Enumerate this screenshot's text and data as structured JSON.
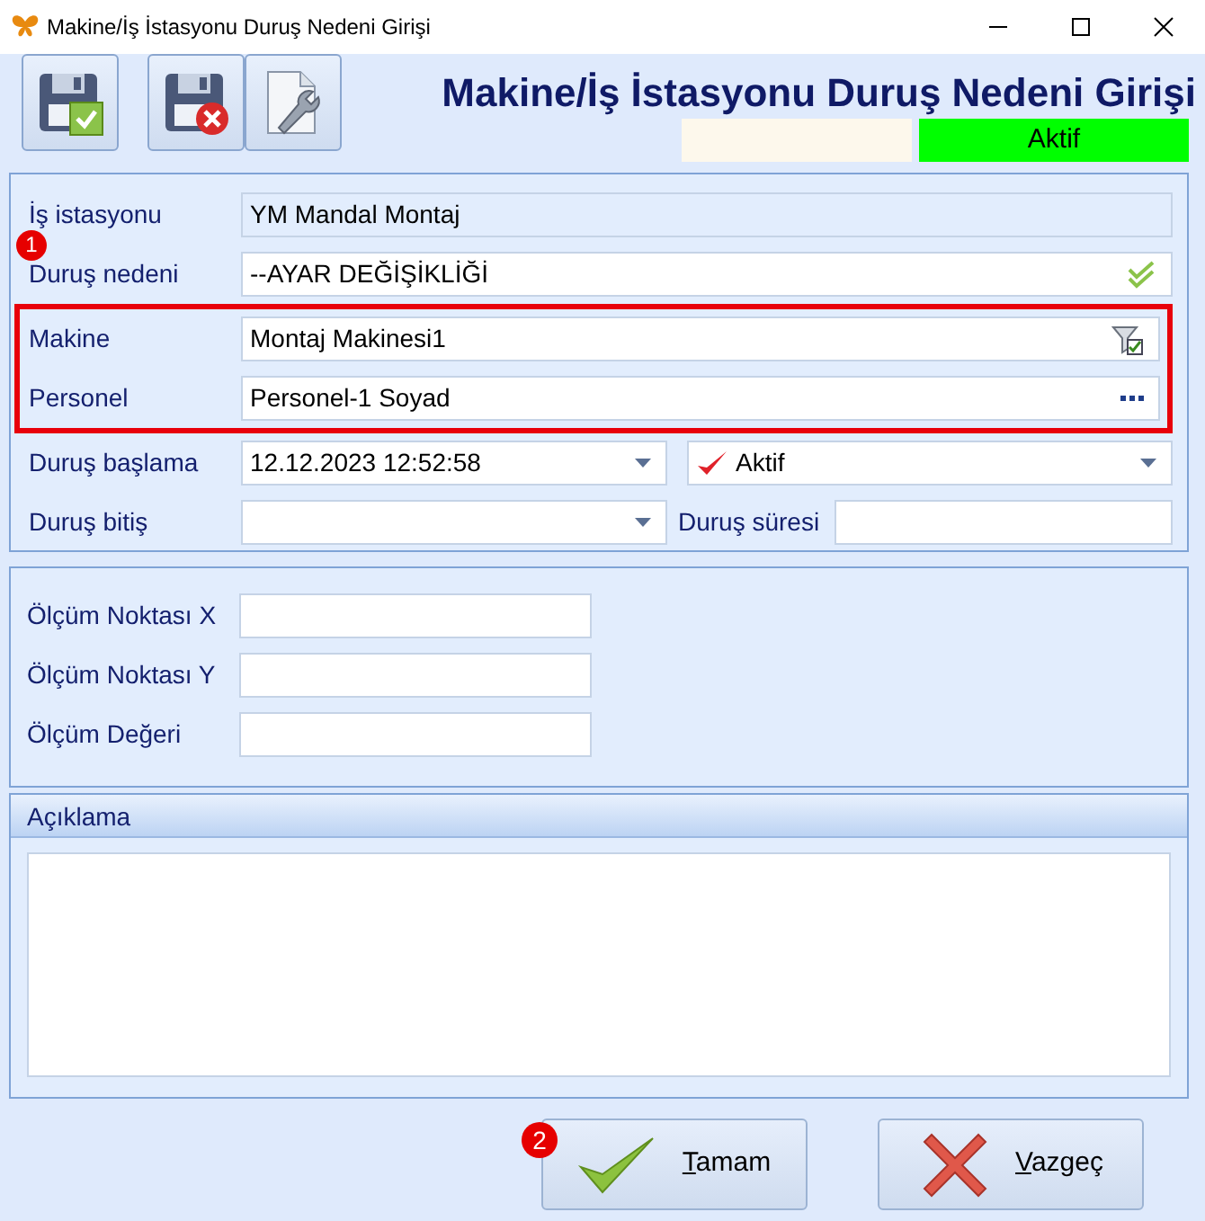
{
  "window": {
    "title": "Makine/İş İstasyonu Duruş Nedeni Girişi"
  },
  "header": {
    "title": "Makine/İş İstasyonu Duruş Nedeni Girişi",
    "status": "Aktif"
  },
  "form": {
    "callout": "1",
    "rows": [
      {
        "highlighted": false,
        "items": [
          {
            "label": "İş istasyonu",
            "value": "YM Mandal Montaj",
            "kind": "readonly"
          }
        ]
      },
      {
        "highlighted": false,
        "items": [
          {
            "label": "Duruş nedeni",
            "value": "--AYAR DEĞİŞİKLİĞİ",
            "kind": "check-lookup"
          }
        ]
      },
      {
        "highlighted": true,
        "items": [
          {
            "label": "Makine",
            "value": "Montaj Makinesi1",
            "kind": "filter-lookup"
          }
        ]
      },
      {
        "highlighted": true,
        "items": [
          {
            "label": "Personel",
            "value": "Personel-1 Soyad",
            "kind": "ellipsis"
          }
        ]
      },
      {
        "highlighted": false,
        "items": [
          {
            "label": "Duruş başlama",
            "value": "12.12.2023 12:52:58",
            "kind": "dropdown"
          },
          {
            "value": "Aktif",
            "kind": "status-dropdown"
          }
        ]
      },
      {
        "highlighted": false,
        "items": [
          {
            "label": "Duruş bitiş",
            "kind": "dropdown"
          },
          {
            "label": "Duruş süresi",
            "kind": "text"
          }
        ]
      }
    ]
  },
  "measurements": [
    {
      "label": "Ölçüm Noktası X"
    },
    {
      "label": "Ölçüm Noktası Y"
    },
    {
      "label": "Ölçüm Değeri"
    }
  ],
  "notes": {
    "title": "Açıklama"
  },
  "buttons": {
    "callout": "2",
    "items": [
      {
        "label": "Tamam",
        "kind": "ok"
      },
      {
        "label": "Vazgeç",
        "kind": "cancel"
      }
    ]
  }
}
